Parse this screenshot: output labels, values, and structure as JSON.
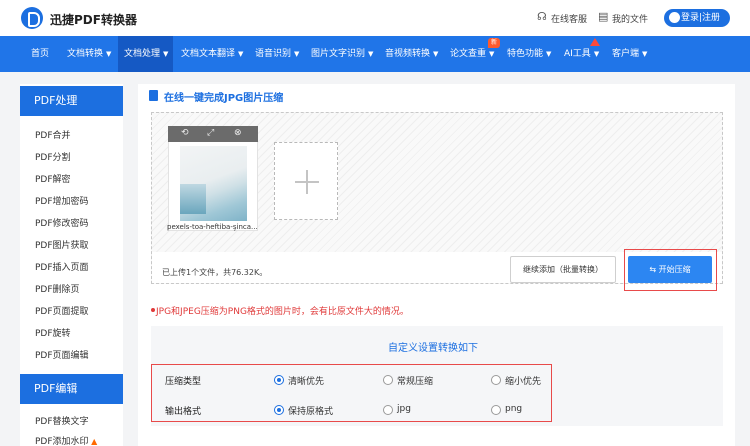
{
  "header": {
    "brand": "迅捷PDF转换器",
    "service": "在线客服",
    "my_files": "我的文件",
    "login": "登录|注册"
  },
  "nav": {
    "items": [
      "首页",
      "文档转换",
      "文档处理",
      "文档文本翻译",
      "语音识别",
      "图片文字识别",
      "音视频转换",
      "论文查重",
      "特色功能",
      "AI工具",
      "客户端"
    ],
    "new_badge": "新"
  },
  "sidebar": {
    "section1": "PDF处理",
    "items1": [
      "PDF合并",
      "PDF分割",
      "PDF解密",
      "PDF增加密码",
      "PDF修改密码",
      "PDF图片获取",
      "PDF插入页面",
      "PDF删除页",
      "PDF页面提取",
      "PDF旋转",
      "PDF页面编辑"
    ],
    "section2": "PDF编辑",
    "items2": [
      "PDF替换文字",
      "PDF添加水印"
    ]
  },
  "main": {
    "title": "在线一键完成JPG图片压缩",
    "file_name": "pexels-toa-heftiba-şinca...",
    "count_text": "已上传1个文件，共76.32K。",
    "continue_btn": "继续添加（批量转换）",
    "start_btn": "开始压缩",
    "note": "JPG和JPEG压缩为PNG格式的图片时，会有比原文件大的情况。"
  },
  "settings": {
    "title": "自定义设置转换如下",
    "row1_label": "压缩类型",
    "row1_options": [
      "清晰优先",
      "常规压缩",
      "缩小优先"
    ],
    "row1_selected": "清晰优先",
    "row2_label": "输出格式",
    "row2_options": [
      "保持原格式",
      "jpg",
      "png"
    ],
    "row2_selected": "保持原格式"
  },
  "colors": {
    "primary": "#1c6fe0",
    "nav": "#2075e8",
    "highlight": "#e84a4a",
    "note": "#e03a3a"
  }
}
